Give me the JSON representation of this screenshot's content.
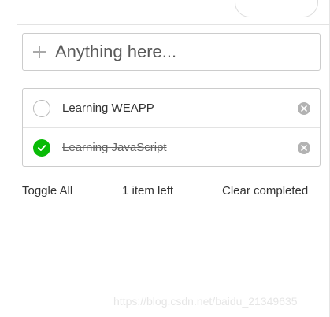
{
  "input": {
    "placeholder": "Anything here...",
    "icon": "plus-icon"
  },
  "todos": [
    {
      "label": "Learning WEAPP",
      "completed": false
    },
    {
      "label": "Learning JavaScript",
      "completed": true
    }
  ],
  "footer": {
    "toggle_all": "Toggle All",
    "items_left": "1 item left",
    "clear_completed": "Clear completed"
  },
  "watermark": "https://blog.csdn.net/baidu_21349635",
  "colors": {
    "accent": "#09bb07",
    "clear_icon": "#b2b2b2",
    "border": "#cccccc"
  }
}
